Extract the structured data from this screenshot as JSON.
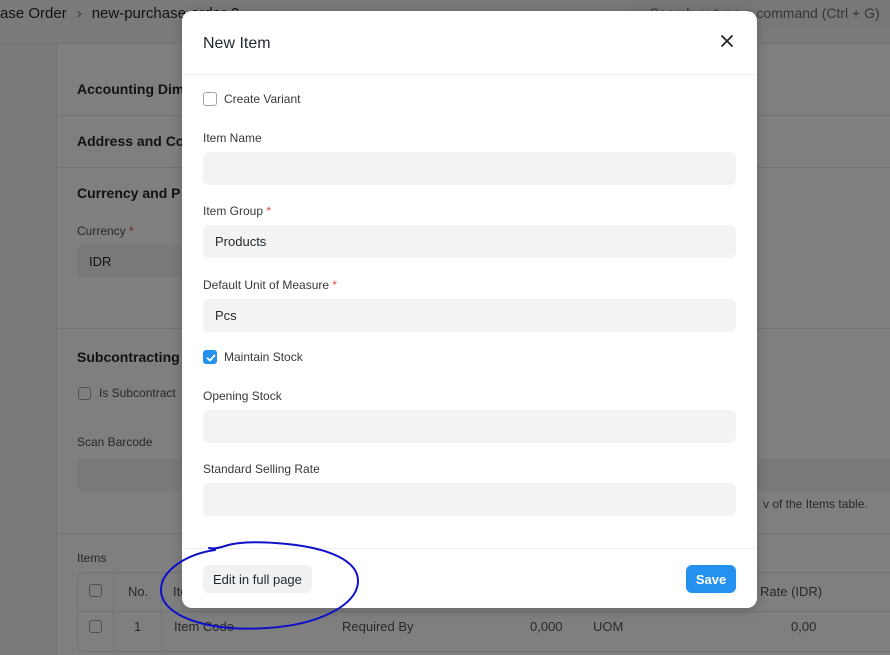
{
  "topbar": {
    "breadcrumbs": [
      "ase Order",
      "new-purchase-order-2"
    ],
    "search_text": "Search or type a command (Ctrl + G)"
  },
  "background_form": {
    "sections": {
      "accounting": "Accounting Dim",
      "address": "Address and Co",
      "currency": "Currency and P",
      "subcontracting": "Subcontracting"
    },
    "currency_label": "Currency",
    "currency_value": "IDR",
    "is_subcontracted_label": "Is Subcontract",
    "scan_barcode_label": "Scan Barcode",
    "items_hint": "v of the Items table.",
    "items_label": "Items",
    "table": {
      "headers": {
        "no": "No.",
        "item": "Ite",
        "rate": "Rate (IDR)"
      },
      "row": {
        "no": "1",
        "item_code": "Item Code",
        "required_by": "Required By",
        "qty": "0,000",
        "uom": "UOM",
        "rate": "0,00"
      }
    }
  },
  "modal": {
    "title": "New Item",
    "create_variant_label": "Create Variant",
    "item_name": {
      "label": "Item Name",
      "value": ""
    },
    "item_group": {
      "label": "Item Group",
      "value": "Products"
    },
    "uom": {
      "label": "Default Unit of Measure",
      "value": "Pcs"
    },
    "maintain_stock_label": "Maintain Stock",
    "opening_stock": {
      "label": "Opening Stock",
      "value": ""
    },
    "selling_rate": {
      "label": "Standard Selling Rate",
      "value": ""
    },
    "edit_full_page_label": "Edit in full page",
    "save_label": "Save",
    "required_mark": "*"
  },
  "colors": {
    "primary": "#2490ef",
    "required": "#e24c4c",
    "annotation_ink": "#1010c8"
  }
}
